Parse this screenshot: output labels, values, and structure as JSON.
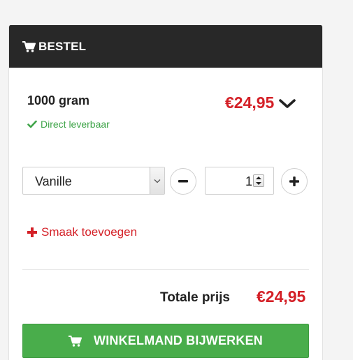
{
  "panel": {
    "title": "BESTEL",
    "icon": "cart-icon"
  },
  "product": {
    "name": "1000 gram",
    "price": "€24,95",
    "stock_status": "Direct leverbaar",
    "expand_icon": "chevron-down-icon"
  },
  "options": {
    "flavor_selected": "Vanille",
    "quantity": "1",
    "add_flavor_label": "Smaak toevoegen"
  },
  "summary": {
    "total_label": "Totale prijs",
    "total_value": "€24,95"
  },
  "actions": {
    "update_cart_label": "WINKELMAND BIJWERKEN"
  },
  "colors": {
    "header_bg": "#282828",
    "price_red": "#d42027",
    "stock_green": "#3fa449",
    "button_green": "#49ad4b"
  }
}
